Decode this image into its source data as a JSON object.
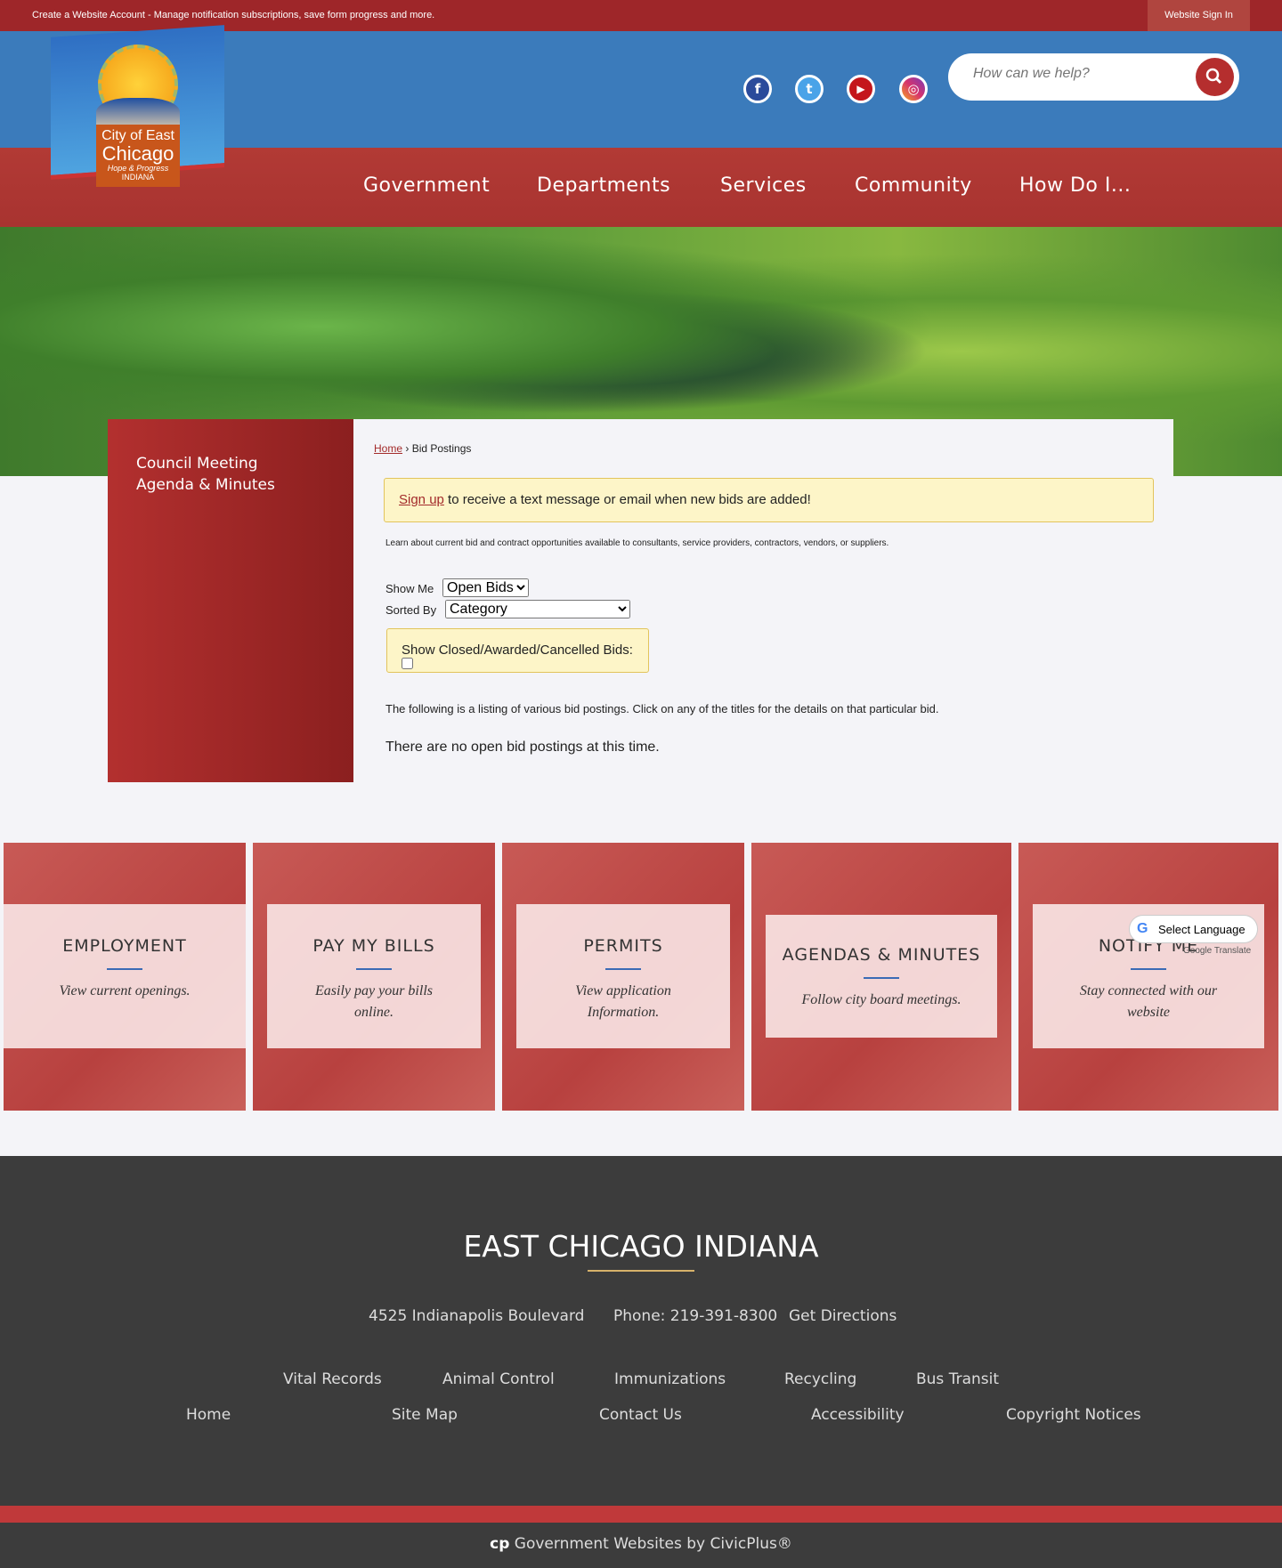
{
  "topbar": {
    "message": "Create a Website Account - Manage notification subscriptions, save form progress and more.",
    "sign_in": "Website Sign In"
  },
  "logo": {
    "line1": "City of East",
    "line2": "Chicago",
    "line3": "Hope & Progress",
    "line4": "INDIANA"
  },
  "social": [
    {
      "icon": "facebook-icon",
      "glyph": "f",
      "color": "#2b4b9b"
    },
    {
      "icon": "twitter-icon",
      "glyph": "t",
      "color": "#4aa3e8"
    },
    {
      "icon": "youtube-icon",
      "glyph": "▶",
      "color": "#c4161c"
    },
    {
      "icon": "instagram-icon",
      "glyph": "◎",
      "color": "#d6336c"
    }
  ],
  "search": {
    "placeholder": "How can we help?"
  },
  "nav": [
    "Government",
    "Departments",
    "Services",
    "Community",
    "How Do I..."
  ],
  "sidebar": {
    "link": "Council Meeting Agenda & Minutes"
  },
  "breadcrumb": {
    "home": "Home",
    "sep": "›",
    "current": "Bid Postings"
  },
  "alert": {
    "link": "Sign up",
    "text": " to receive a text message or email when new bids are added!"
  },
  "intro": "Learn about current bid and contract opportunities available to consultants, service providers, contractors, vendors, or suppliers.",
  "filters": {
    "show_me_label": "Show Me",
    "show_me_value": "Open Bids",
    "sorted_by_label": "Sorted By",
    "sorted_by_value": "Category",
    "closed_label": "Show Closed/Awarded/Cancelled Bids:"
  },
  "listing_text": "The following is a listing of various bid postings. Click on any of the titles for the details on that particular bid.",
  "empty_text": "There are no open bid postings at this time.",
  "cards": [
    {
      "title": "EMPLOYMENT",
      "desc": "View current openings."
    },
    {
      "title": "PAY MY BILLS",
      "desc": "Easily pay your bills online."
    },
    {
      "title": "PERMITS",
      "desc": "View application Information."
    },
    {
      "title": "AGENDAS & MINUTES",
      "desc": "Follow city board meetings."
    },
    {
      "title": "NOTIFY ME",
      "desc": "Stay  connected with our website"
    }
  ],
  "translate": {
    "label": "Select Language",
    "powered": "Google Translate"
  },
  "footer": {
    "title": "EAST CHICAGO INDIANA",
    "address": "4525 Indianapolis Boulevard",
    "phone": "Phone: 219-391-8300",
    "directions": "Get Directions",
    "links1": [
      "Vital Records",
      "Animal Control",
      "Immunizations",
      "Recycling",
      "Bus Transit"
    ],
    "links2": [
      "Home",
      "Site Map",
      "Contact Us",
      "Accessibility",
      "Copyright Notices"
    ],
    "civicplus": "Government Websites by CivicPlus®"
  }
}
